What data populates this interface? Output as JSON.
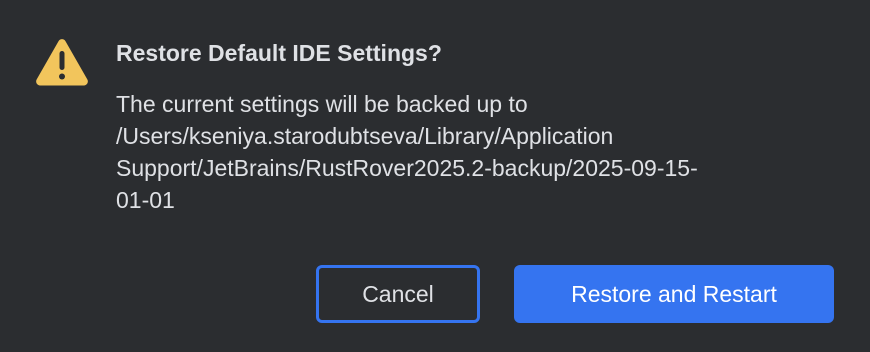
{
  "dialog": {
    "icon": "warning-icon",
    "title": "Restore Default IDE Settings?",
    "message_lines": [
      "The current settings will be backed up to",
      "/Users/kseniya.starodubtseva/Library/Application",
      "Support/JetBrains/RustRover2025.2-backup/2025-09-15-",
      "01-01"
    ],
    "cancel_label": "Cancel",
    "confirm_label": "Restore and Restart"
  },
  "colors": {
    "background": "#2b2d30",
    "text": "#dfe1e5",
    "accent": "#3574f0",
    "warning": "#f2c55c"
  }
}
